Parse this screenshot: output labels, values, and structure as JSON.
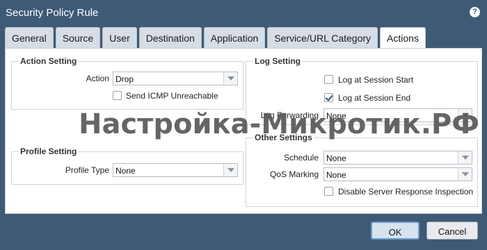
{
  "window": {
    "title": "Security Policy Rule",
    "help_icon": "?"
  },
  "tabs": [
    {
      "label": "General"
    },
    {
      "label": "Source"
    },
    {
      "label": "User"
    },
    {
      "label": "Destination"
    },
    {
      "label": "Application"
    },
    {
      "label": "Service/URL Category"
    },
    {
      "label": "Actions",
      "active": true
    }
  ],
  "action_setting": {
    "title": "Action Setting",
    "action_label": "Action",
    "action_value": "Drop",
    "send_icmp_label": "Send ICMP Unreachable",
    "send_icmp_checked": false
  },
  "profile_setting": {
    "title": "Profile Setting",
    "profile_type_label": "Profile Type",
    "profile_type_value": "None"
  },
  "log_setting": {
    "title": "Log Setting",
    "log_start_label": "Log at Session Start",
    "log_start_checked": false,
    "log_end_label": "Log at Session End",
    "log_end_checked": true,
    "log_forwarding_label": "Log Forwarding",
    "log_forwarding_value": "None"
  },
  "other_settings": {
    "title": "Other Settings",
    "schedule_label": "Schedule",
    "schedule_value": "None",
    "qos_label": "QoS Marking",
    "qos_value": "None",
    "disable_sri_label": "Disable Server Response Inspection",
    "disable_sri_checked": false
  },
  "watermark": "Настройка-Микротик.РФ",
  "buttons": {
    "ok": "OK",
    "cancel": "Cancel"
  }
}
